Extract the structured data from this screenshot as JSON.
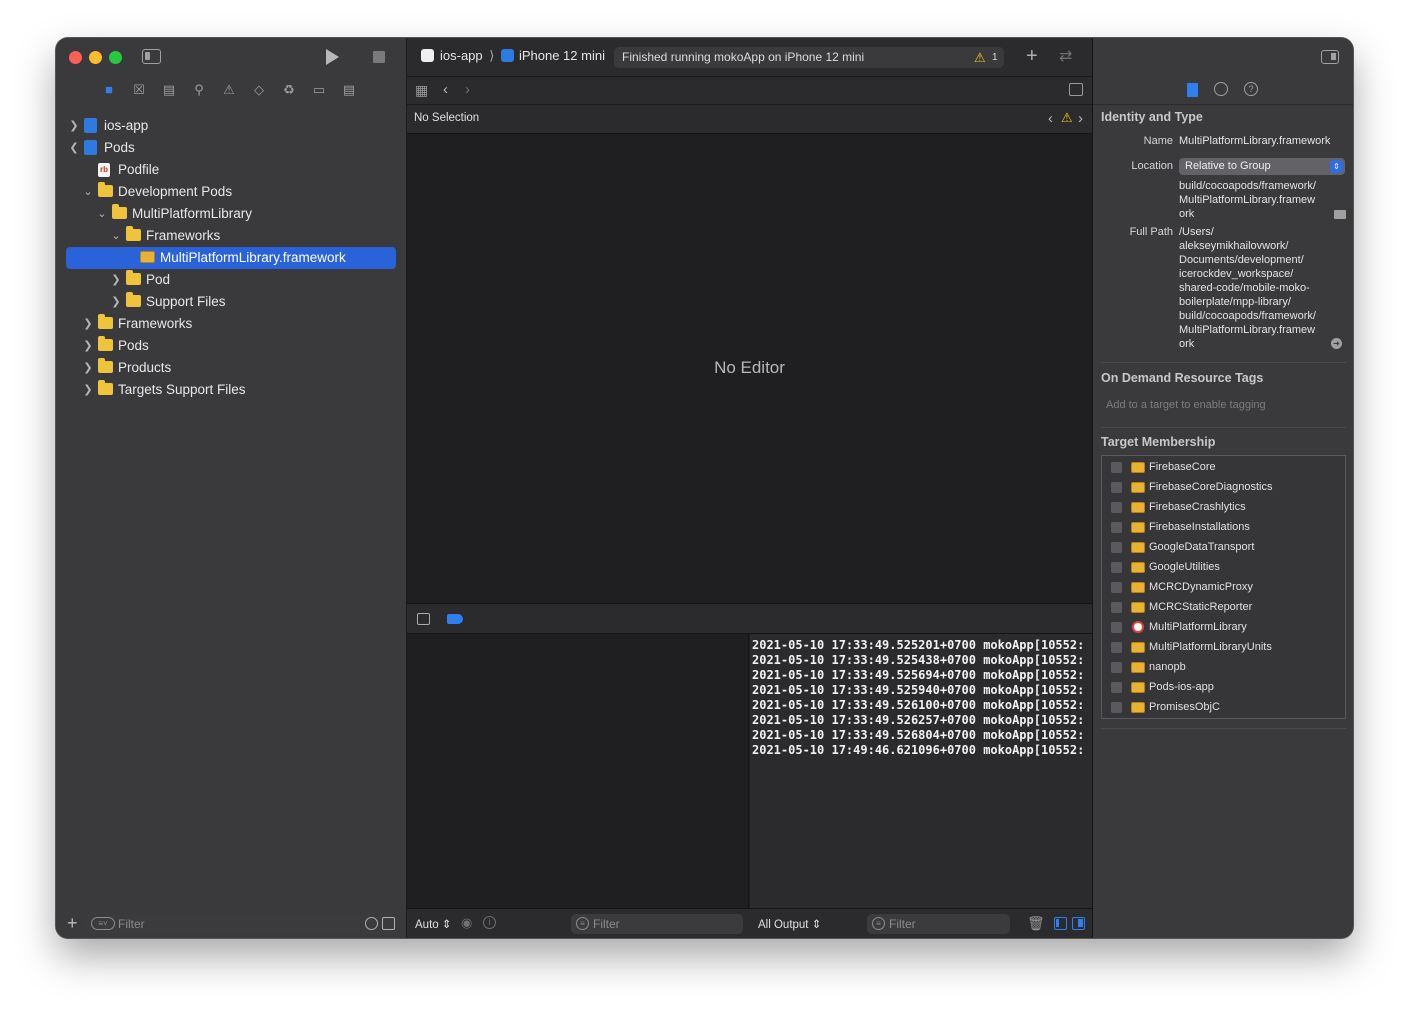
{
  "toolbar": {
    "scheme_name": "ios-app",
    "device_name": "iPhone 12 mini",
    "activity_status": "Finished running mokoApp on iPhone 12 mini",
    "warning_count": "1"
  },
  "navigator": {
    "tree": [
      {
        "label": "ios-app",
        "kind": "project",
        "expanded": false
      },
      {
        "label": "Pods",
        "kind": "project",
        "expanded": true
      },
      {
        "label": "Podfile",
        "kind": "ruby-file"
      },
      {
        "label": "Development Pods",
        "kind": "folder",
        "expanded": true
      },
      {
        "label": "MultiPlatformLibrary",
        "kind": "folder",
        "expanded": true
      },
      {
        "label": "Frameworks",
        "kind": "folder",
        "expanded": true
      },
      {
        "label": "MultiPlatformLibrary.framework",
        "kind": "framework",
        "selected": true
      },
      {
        "label": "Pod",
        "kind": "folder",
        "expanded": false
      },
      {
        "label": "Support Files",
        "kind": "folder",
        "expanded": false
      },
      {
        "label": "Frameworks",
        "kind": "folder",
        "expanded": false
      },
      {
        "label": "Pods",
        "kind": "folder",
        "expanded": false
      },
      {
        "label": "Products",
        "kind": "folder",
        "expanded": false
      },
      {
        "label": "Targets Support Files",
        "kind": "folder",
        "expanded": false
      }
    ],
    "filter_placeholder": "Filter"
  },
  "editor": {
    "breadcrumb": "No Selection",
    "empty_message": "No Editor"
  },
  "debug": {
    "console_lines": [
      "2021-05-10 17:33:49.525201+0700 mokoApp[10552:",
      "2021-05-10 17:33:49.525438+0700 mokoApp[10552:",
      "2021-05-10 17:33:49.525694+0700 mokoApp[10552:",
      "2021-05-10 17:33:49.525940+0700 mokoApp[10552:",
      "2021-05-10 17:33:49.526100+0700 mokoApp[10552:",
      "2021-05-10 17:33:49.526257+0700 mokoApp[10552:",
      "2021-05-10 17:33:49.526804+0700 mokoApp[10552:",
      "2021-05-10 17:49:46.621096+0700 mokoApp[10552:"
    ],
    "variables_mode": "Auto",
    "vars_filter_placeholder": "Filter",
    "output_mode": "All Output",
    "console_filter_placeholder": "Filter"
  },
  "inspector": {
    "identity_title": "Identity and Type",
    "name_key": "Name",
    "name_value": "MultiPlatformLibrary.framework",
    "location_key": "Location",
    "location_value": "Relative to Group",
    "relative_path": "build/cocoapods/framework/\nMultiPlatformLibrary.framew\nork",
    "full_path_key": "Full Path",
    "full_path_value": "/Users/\nalekseymikhailovwork/\nDocuments/development/\nicerockdev_workspace/\nshared-code/mobile-moko-\nboilerplate/mpp-library/\nbuild/cocoapods/framework/\nMultiPlatformLibrary.framew\nork",
    "tags_title": "On Demand Resource Tags",
    "tags_placeholder": "Add to a target to enable tagging",
    "membership_title": "Target Membership",
    "targets": [
      {
        "name": "FirebaseCore",
        "icon": "toolbox-icon"
      },
      {
        "name": "FirebaseCoreDiagnostics",
        "icon": "toolbox-icon"
      },
      {
        "name": "FirebaseCrashlytics",
        "icon": "toolbox-icon"
      },
      {
        "name": "FirebaseInstallations",
        "icon": "toolbox-icon"
      },
      {
        "name": "GoogleDataTransport",
        "icon": "toolbox-icon"
      },
      {
        "name": "GoogleUtilities",
        "icon": "toolbox-icon"
      },
      {
        "name": "MCRCDynamicProxy",
        "icon": "toolbox-icon"
      },
      {
        "name": "MCRCStaticReporter",
        "icon": "toolbox-icon"
      },
      {
        "name": "MultiPlatformLibrary",
        "icon": "target-icon"
      },
      {
        "name": "MultiPlatformLibraryUnits",
        "icon": "toolbox-icon"
      },
      {
        "name": "nanopb",
        "icon": "toolbox-icon"
      },
      {
        "name": "Pods-ios-app",
        "icon": "toolbox-icon"
      },
      {
        "name": "PromisesObjC",
        "icon": "toolbox-icon"
      }
    ]
  },
  "colors": {
    "accent": "#2a62d9",
    "folder": "#f0c33c",
    "warning": "#f5c518"
  }
}
